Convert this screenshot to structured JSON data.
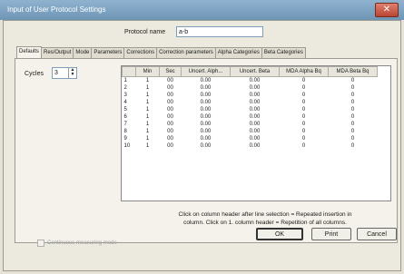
{
  "window": {
    "title": "Input of User Protocol Settings",
    "close": "✕"
  },
  "protocol": {
    "label": "Protocol name",
    "value": "a-b"
  },
  "tabs": [
    "Defaults",
    "Res/Output",
    "Mode",
    "Parameters",
    "Corrections",
    "Correction parameters",
    "Alpha Categories",
    "Beta Categories"
  ],
  "cycles": {
    "label": "Cycles",
    "value": "3"
  },
  "table": {
    "headers": [
      "",
      "Min",
      "Sec",
      "Uncert. Alph...",
      "Uncert. Beta",
      "MDA Alpha Bq",
      "MDA Beta Bq"
    ],
    "rows": [
      [
        "1",
        "1",
        "00",
        "0.00",
        "0.00",
        "0",
        "0"
      ],
      [
        "2",
        "1",
        "00",
        "0.00",
        "0.00",
        "0",
        "0"
      ],
      [
        "3",
        "1",
        "00",
        "0.00",
        "0.00",
        "0",
        "0"
      ],
      [
        "4",
        "1",
        "00",
        "0.00",
        "0.00",
        "0",
        "0"
      ],
      [
        "5",
        "1",
        "00",
        "0.00",
        "0.00",
        "0",
        "0"
      ],
      [
        "6",
        "1",
        "00",
        "0.00",
        "0.00",
        "0",
        "0"
      ],
      [
        "7",
        "1",
        "00",
        "0.00",
        "0.00",
        "0",
        "0"
      ],
      [
        "8",
        "1",
        "00",
        "0.00",
        "0.00",
        "0",
        "0"
      ],
      [
        "9",
        "1",
        "00",
        "0.00",
        "0.00",
        "0",
        "0"
      ],
      [
        "10",
        "1",
        "00",
        "0.00",
        "0.00",
        "0",
        "0"
      ]
    ]
  },
  "note": {
    "line1": "Click on column header after line selection = Repeated insertion in",
    "line2": "column. Click on 1. column header = Repetition of all columns."
  },
  "continuous_label": "Continuous measuring mode",
  "buttons": {
    "ok": "OK",
    "print": "Print",
    "cancel": "Cancel"
  }
}
